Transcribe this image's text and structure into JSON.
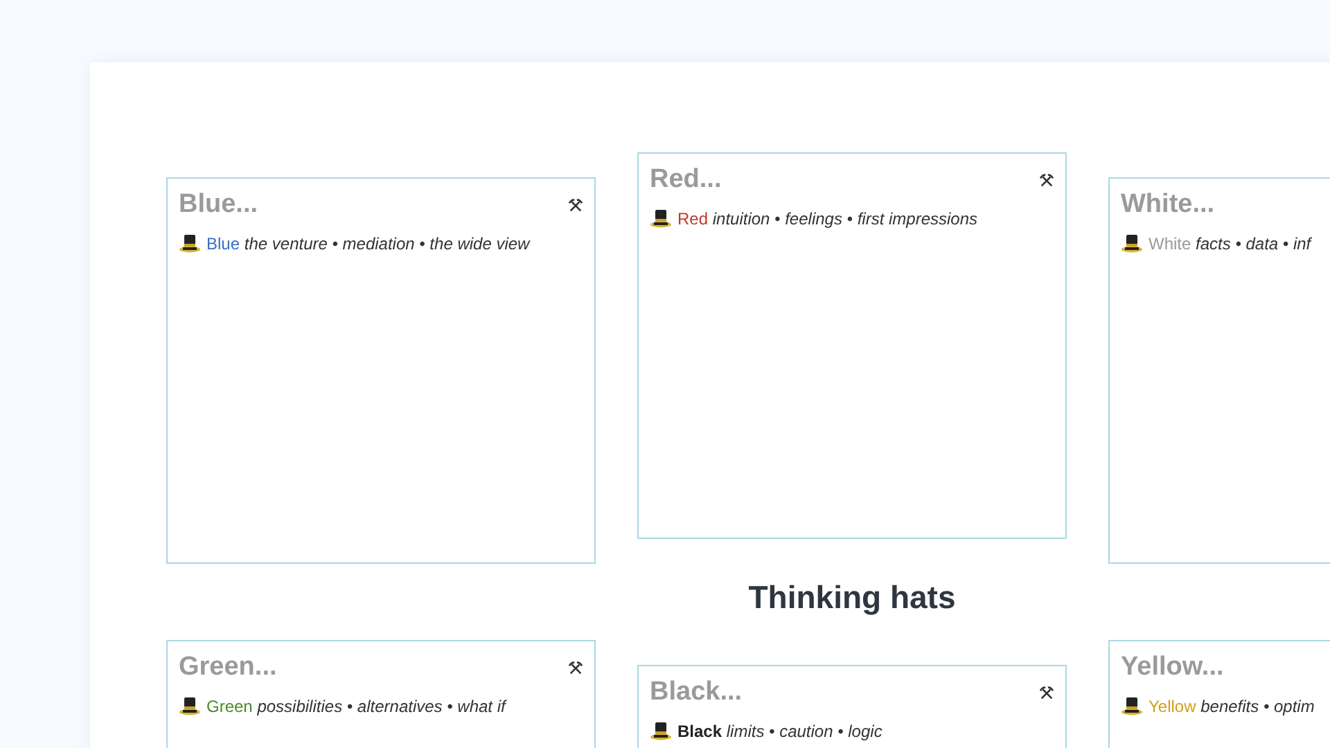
{
  "rows": [
    {
      "hats": [
        {
          "title": "Blue...",
          "name": "Blue",
          "color": "#3b6fc4",
          "bold": false,
          "traits": "the venture • mediation • the wide view"
        },
        {
          "title": "Red...",
          "name": "Red",
          "color": "#c0392b",
          "bold": false,
          "traits": "intuition • feelings • first impressions"
        },
        {
          "title": "White...",
          "name": "White",
          "color": "#9a9a9a",
          "bold": false,
          "traits": "facts • data • inf"
        }
      ]
    },
    {
      "hats": [
        {
          "title": "Green...",
          "name": "Green",
          "color": "#4a8a2a",
          "bold": false,
          "traits": "possibilities • alternatives • what if"
        },
        {
          "title": "Black...",
          "name": "Black",
          "color": "#222222",
          "bold": true,
          "traits": "limits • caution • logic"
        },
        {
          "title": "Yellow...",
          "name": "Yellow",
          "color": "#d4a017",
          "bold": false,
          "traits": "benefits • optim"
        }
      ]
    }
  ],
  "heading": "Thinking hats"
}
